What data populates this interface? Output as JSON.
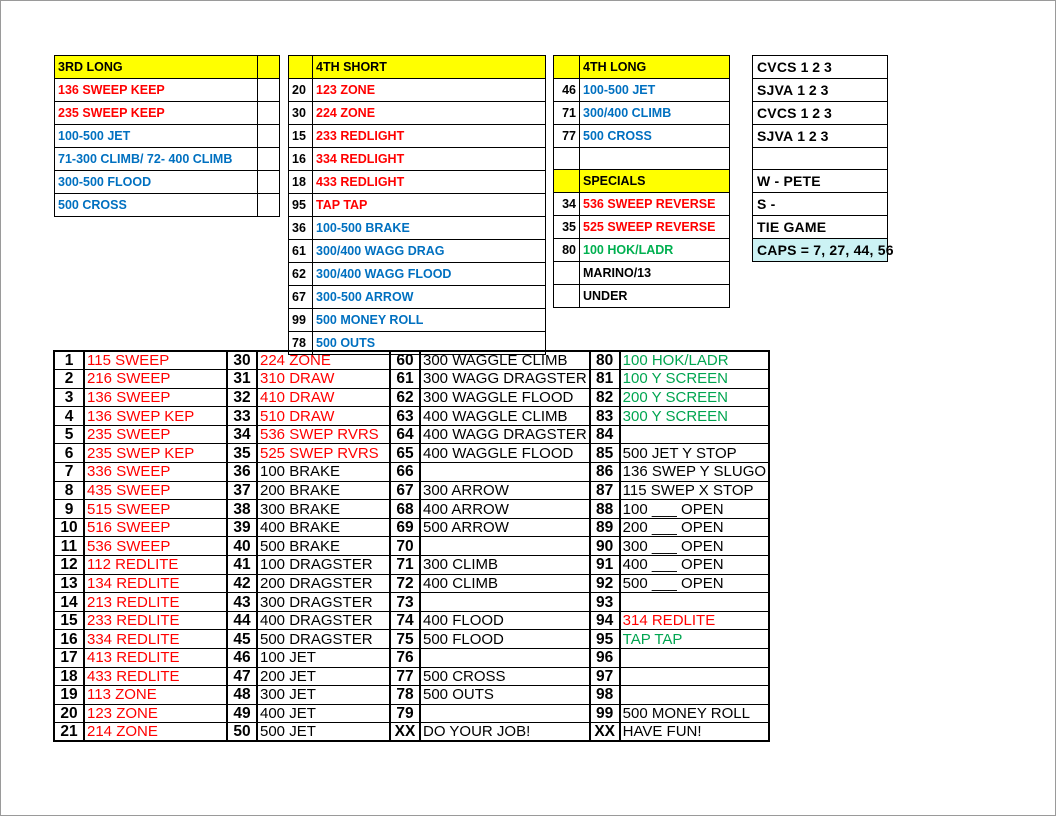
{
  "top": {
    "situations": [
      {
        "header": "3RD LONG",
        "rows": [
          {
            "num": "",
            "text": "136 SWEEP KEEP",
            "color": "red"
          },
          {
            "num": "",
            "text": "235 SWEEP KEEP",
            "color": "red"
          },
          {
            "num": "",
            "text": "100-500 JET",
            "color": "blue"
          },
          {
            "num": "",
            "text": "71-300 CLIMB/ 72- 400 CLIMB",
            "color": "blue"
          },
          {
            "num": "",
            "text": "300-500 FLOOD",
            "color": "blue"
          },
          {
            "num": "",
            "text": "500 CROSS",
            "color": "blue"
          }
        ]
      },
      {
        "header": "4TH SHORT",
        "rows": [
          {
            "num": "20",
            "text": "123 ZONE",
            "color": "red"
          },
          {
            "num": "30",
            "text": "224 ZONE",
            "color": "red"
          },
          {
            "num": "15",
            "text": "233 REDLIGHT",
            "color": "red"
          },
          {
            "num": "16",
            "text": "334 REDLIGHT",
            "color": "red"
          },
          {
            "num": "18",
            "text": "433 REDLIGHT",
            "color": "red"
          },
          {
            "num": "95",
            "text": "TAP TAP",
            "color": "red"
          },
          {
            "num": "36",
            "text": "100-500 BRAKE",
            "color": "blue"
          },
          {
            "num": "61",
            "text": "300/400 WAGG DRAG",
            "color": "blue"
          },
          {
            "num": "62",
            "text": "300/400 WAGG FLOOD",
            "color": "blue"
          },
          {
            "num": "67",
            "text": "300-500 ARROW",
            "color": "blue"
          },
          {
            "num": "99",
            "text": "500 MONEY ROLL",
            "color": "blue"
          },
          {
            "num": "78",
            "text": "500 OUTS",
            "color": "blue"
          }
        ]
      },
      {
        "header": "4TH LONG",
        "rows": [
          {
            "num": "46",
            "text": "100-500 JET",
            "color": "blue"
          },
          {
            "num": "71",
            "text": "300/400 CLIMB",
            "color": "blue"
          },
          {
            "num": "77",
            "text": "500 CROSS",
            "color": "blue"
          }
        ],
        "header2": "SPECIALS",
        "rows2": [
          {
            "num": "34",
            "text": "536 SWEEP REVERSE",
            "color": "red"
          },
          {
            "num": "35",
            "text": "525 SWEEP REVERSE",
            "color": "red"
          },
          {
            "num": "80",
            "text": "100 HOK/LADR",
            "color": "green"
          },
          {
            "num": "",
            "text": "MARINO/13",
            "color": "black"
          },
          {
            "num": "",
            "text": "UNDER",
            "color": "black"
          }
        ]
      }
    ]
  },
  "info_panel": {
    "rows": [
      {
        "label": "CVCS",
        "nums": "1    2    3",
        "highlight": false
      },
      {
        "label": "SJVA",
        "nums": "1    2    3",
        "highlight": false
      },
      {
        "label": "CVCS",
        "nums": "1    2    3",
        "highlight": false
      },
      {
        "label": "SJVA",
        "nums": "1    2    3",
        "highlight": false
      },
      {
        "label": "",
        "nums": "",
        "highlight": false
      },
      {
        "label": "W - PETE",
        "nums": "",
        "highlight": false
      },
      {
        "label": "S -",
        "nums": "",
        "highlight": false
      },
      {
        "label": "TIE GAME",
        "nums": "",
        "highlight": false
      },
      {
        "label": "CAPS = 7, 27, 44, 56",
        "nums": "",
        "highlight": true
      }
    ]
  },
  "playlist": {
    "columns": [
      {
        "entries": [
          {
            "num": "1",
            "text": "115 SWEEP",
            "color": "red"
          },
          {
            "num": "2",
            "text": "216 SWEEP",
            "color": "red"
          },
          {
            "num": "3",
            "text": "136 SWEEP",
            "color": "red"
          },
          {
            "num": "4",
            "text": "136 SWEP KEP",
            "color": "red"
          },
          {
            "num": "5",
            "text": "235 SWEEP",
            "color": "red"
          },
          {
            "num": "6",
            "text": "235 SWEP KEP",
            "color": "red"
          },
          {
            "num": "7",
            "text": "336 SWEEP",
            "color": "red"
          },
          {
            "num": "8",
            "text": "435 SWEEP",
            "color": "red"
          },
          {
            "num": "9",
            "text": "515 SWEEP",
            "color": "red"
          },
          {
            "num": "10",
            "text": "516 SWEEP",
            "color": "red"
          },
          {
            "num": "11",
            "text": "536 SWEEP",
            "color": "red"
          },
          {
            "num": "12",
            "text": "112 REDLITE",
            "color": "red"
          },
          {
            "num": "13",
            "text": "134 REDLITE",
            "color": "red"
          },
          {
            "num": "14",
            "text": "213 REDLITE",
            "color": "red"
          },
          {
            "num": "15",
            "text": "233 REDLITE",
            "color": "red"
          },
          {
            "num": "16",
            "text": "334 REDLITE",
            "color": "red"
          },
          {
            "num": "17",
            "text": "413 REDLITE",
            "color": "red"
          },
          {
            "num": "18",
            "text": "433 REDLITE",
            "color": "red"
          },
          {
            "num": "19",
            "text": "113 ZONE",
            "color": "red"
          },
          {
            "num": "20",
            "text": "123 ZONE",
            "color": "red"
          },
          {
            "num": "21",
            "text": "214 ZONE",
            "color": "red"
          }
        ]
      },
      {
        "entries": [
          {
            "num": "30",
            "text": "224 ZONE",
            "color": "red"
          },
          {
            "num": "31",
            "text": "310 DRAW",
            "color": "red"
          },
          {
            "num": "32",
            "text": "410 DRAW",
            "color": "red"
          },
          {
            "num": "33",
            "text": "510 DRAW",
            "color": "red"
          },
          {
            "num": "34",
            "text": "536 SWEP RVRS",
            "color": "red"
          },
          {
            "num": "35",
            "text": "525 SWEP RVRS",
            "color": "red"
          },
          {
            "num": "36",
            "text": "100 BRAKE",
            "color": "black"
          },
          {
            "num": "37",
            "text": "200 BRAKE",
            "color": "black"
          },
          {
            "num": "38",
            "text": "300 BRAKE",
            "color": "black"
          },
          {
            "num": "39",
            "text": "400 BRAKE",
            "color": "black"
          },
          {
            "num": "40",
            "text": "500 BRAKE",
            "color": "black"
          },
          {
            "num": "41",
            "text": "100 DRAGSTER",
            "color": "black"
          },
          {
            "num": "42",
            "text": "200 DRAGSTER",
            "color": "black"
          },
          {
            "num": "43",
            "text": "300 DRAGSTER",
            "color": "black"
          },
          {
            "num": "44",
            "text": "400 DRAGSTER",
            "color": "black"
          },
          {
            "num": "45",
            "text": "500 DRAGSTER",
            "color": "black"
          },
          {
            "num": "46",
            "text": "100 JET",
            "color": "black"
          },
          {
            "num": "47",
            "text": "200 JET",
            "color": "black"
          },
          {
            "num": "48",
            "text": "300 JET",
            "color": "black"
          },
          {
            "num": "49",
            "text": "400 JET",
            "color": "black"
          },
          {
            "num": "50",
            "text": "500 JET",
            "color": "black"
          }
        ]
      },
      {
        "entries": [
          {
            "num": "60",
            "text": "300 WAGGLE CLIMB",
            "color": "black"
          },
          {
            "num": "61",
            "text": "300 WAGG DRAGSTER",
            "color": "black"
          },
          {
            "num": "62",
            "text": "300 WAGGLE FLOOD",
            "color": "black"
          },
          {
            "num": "63",
            "text": "400 WAGGLE CLIMB",
            "color": "black"
          },
          {
            "num": "64",
            "text": "400 WAGG DRAGSTER",
            "color": "black"
          },
          {
            "num": "65",
            "text": "400 WAGGLE FLOOD",
            "color": "black"
          },
          {
            "num": "66",
            "text": "",
            "color": "black"
          },
          {
            "num": "67",
            "text": "300 ARROW",
            "color": "black"
          },
          {
            "num": "68",
            "text": "400 ARROW",
            "color": "black"
          },
          {
            "num": "69",
            "text": "500 ARROW",
            "color": "black"
          },
          {
            "num": "70",
            "text": "",
            "color": "black"
          },
          {
            "num": "71",
            "text": "300 CLIMB",
            "color": "black"
          },
          {
            "num": "72",
            "text": "400 CLIMB",
            "color": "black"
          },
          {
            "num": "73",
            "text": "",
            "color": "black"
          },
          {
            "num": "74",
            "text": "400 FLOOD",
            "color": "black"
          },
          {
            "num": "75",
            "text": "500 FLOOD",
            "color": "black"
          },
          {
            "num": "76",
            "text": "",
            "color": "black"
          },
          {
            "num": "77",
            "text": "500 CROSS",
            "color": "black"
          },
          {
            "num": "78",
            "text": "500 OUTS",
            "color": "black"
          },
          {
            "num": "79",
            "text": "",
            "color": "black"
          },
          {
            "num": "XX",
            "text": "DO YOUR JOB!",
            "color": "black",
            "bold": true
          }
        ]
      },
      {
        "entries": [
          {
            "num": "80",
            "text": "100 HOK/LADR",
            "color": "green",
            "bold": true
          },
          {
            "num": "81",
            "text": "100 Y SCREEN",
            "color": "green",
            "bold": true
          },
          {
            "num": "82",
            "text": "200 Y SCREEN",
            "color": "green",
            "bold": true
          },
          {
            "num": "83",
            "text": "300 Y SCREEN",
            "color": "green",
            "bold": true
          },
          {
            "num": "84",
            "text": "",
            "color": "black"
          },
          {
            "num": "85",
            "text": "500 JET Y STOP",
            "color": "black"
          },
          {
            "num": "86",
            "text": "136 SWEP Y SLUGO",
            "color": "black",
            "small": true
          },
          {
            "num": "87",
            "text": "115 SWEP X STOP",
            "color": "black",
            "small": true
          },
          {
            "num": "88",
            "text": "100 ___  OPEN",
            "color": "black"
          },
          {
            "num": "89",
            "text": "200 ___  OPEN",
            "color": "black"
          },
          {
            "num": "90",
            "text": "300 ___  OPEN",
            "color": "black"
          },
          {
            "num": "91",
            "text": "400 ___  OPEN",
            "color": "black"
          },
          {
            "num": "92",
            "text": "500 ___  OPEN",
            "color": "black"
          },
          {
            "num": "93",
            "text": "",
            "color": "black"
          },
          {
            "num": "94",
            "text": "314 REDLITE",
            "color": "red"
          },
          {
            "num": "95",
            "text": "TAP TAP",
            "color": "green",
            "bold": true
          },
          {
            "num": "96",
            "text": "",
            "color": "black"
          },
          {
            "num": "97",
            "text": "",
            "color": "black"
          },
          {
            "num": "98",
            "text": "",
            "color": "black"
          },
          {
            "num": "99",
            "text": "500 MONEY ROLL",
            "color": "black"
          },
          {
            "num": "XX",
            "text": "HAVE FUN!",
            "color": "black",
            "bold": true
          }
        ]
      }
    ]
  },
  "colors": {
    "red": "#ff0000",
    "blue": "#0070c0",
    "green": "#00b050",
    "black": "#000000",
    "header_yellow": "#ffff00",
    "caps_cyan": "#ccf2f4"
  }
}
